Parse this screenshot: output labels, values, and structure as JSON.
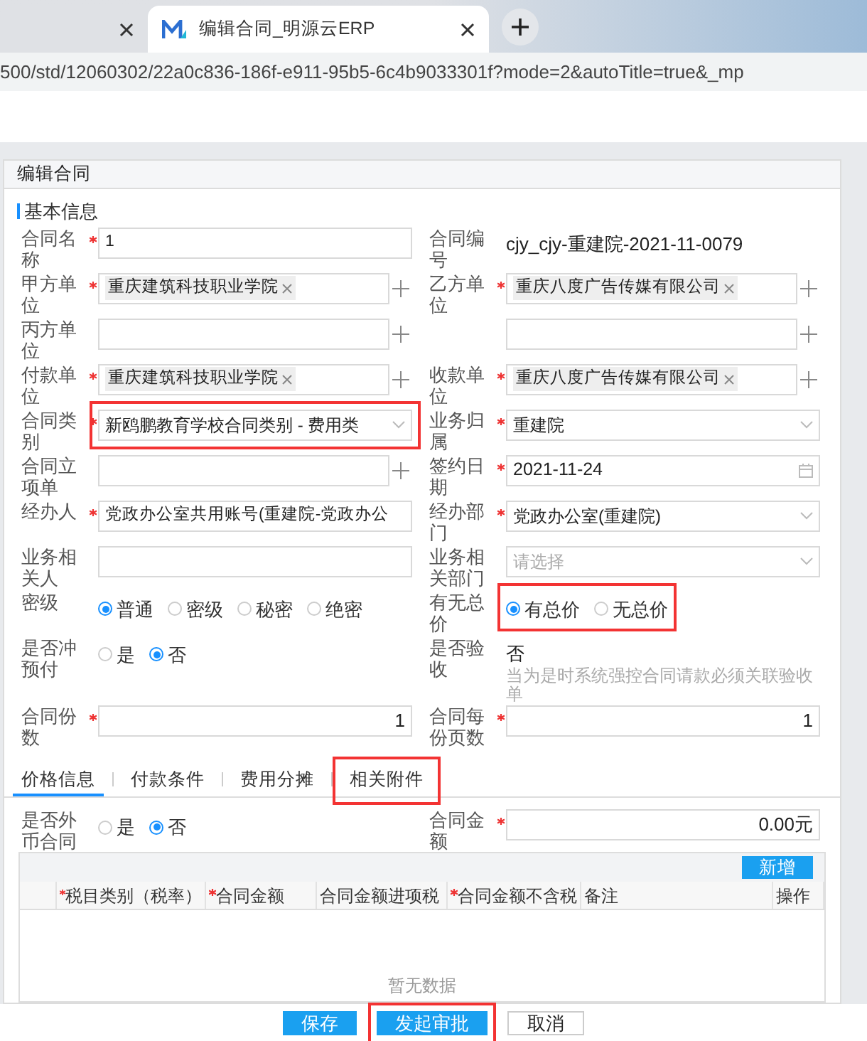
{
  "browser": {
    "tabs": [
      {
        "selected": false
      },
      {
        "title": "编辑合同_明源云ERP",
        "selected": true
      }
    ],
    "url": "500/std/12060302/22a0c836-186f-e911-95b5-6c4b9033301f?mode=2&autoTitle=true&_mp"
  },
  "panel_title": "编辑合同",
  "section_title": "基本信息",
  "rows": [
    [
      {
        "label": "合同名称",
        "required": true,
        "kind": "text",
        "value": "1"
      },
      {
        "label": "合同编号",
        "required": false,
        "kind": "readonly",
        "value": "cjy_cjy-重建院-2021-11-0079"
      }
    ],
    [
      {
        "label": "甲方单位",
        "required": true,
        "kind": "tags",
        "tags": [
          "重庆建筑科技职业学院"
        ],
        "plus": true
      },
      {
        "label": "乙方单位",
        "required": true,
        "kind": "tags",
        "tags": [
          "重庆八度广告传媒有限公司"
        ],
        "plus": true
      }
    ],
    [
      {
        "label": "丙方单位",
        "required": false,
        "kind": "tags",
        "plus": true
      },
      {
        "required": false,
        "kind": "tags",
        "plus": true
      }
    ],
    [
      {
        "label": "付款单位",
        "required": true,
        "kind": "tags",
        "tags": [
          "重庆建筑科技职业学院"
        ],
        "plus": true
      },
      {
        "label": "收款单位",
        "required": true,
        "kind": "tags",
        "tags": [
          "重庆八度广告传媒有限公司"
        ],
        "plus": true
      }
    ],
    [
      {
        "label": "合同类别",
        "required": true,
        "kind": "select",
        "value": "新鸥鹏教育学校合同类别 - 费用类",
        "highlighted": true
      },
      {
        "label": "业务归属",
        "required": true,
        "kind": "select",
        "value": "重建院"
      }
    ],
    [
      {
        "label": "合同立项单",
        "required": false,
        "kind": "tags",
        "plus": true
      },
      {
        "label": "签约日期",
        "required": true,
        "kind": "date",
        "value": "2021-11-24"
      }
    ],
    [
      {
        "label": "经办人",
        "required": true,
        "kind": "text",
        "value": "党政办公室共用账号(重建院-党政办公"
      },
      {
        "label": "经办部门",
        "required": true,
        "kind": "select",
        "value": "党政办公室(重建院)"
      }
    ],
    [
      {
        "label": "业务相关人",
        "required": false,
        "kind": "text"
      },
      {
        "label": "业务相关部门",
        "required": false,
        "kind": "select",
        "placeholder": "请选择"
      }
    ],
    [
      {
        "label": "密级",
        "required": false,
        "kind": "radios",
        "options": [
          {
            "label": "普通",
            "selected": true
          },
          {
            "label": "密级",
            "selected": false
          },
          {
            "label": "秘密",
            "selected": false
          },
          {
            "label": "绝密",
            "selected": false
          }
        ]
      },
      {
        "label": "有无总价",
        "required": false,
        "kind": "radios",
        "highlighted": true,
        "options": [
          {
            "label": "有总价",
            "selected": true
          },
          {
            "label": "无总价",
            "selected": false
          }
        ]
      }
    ],
    [
      {
        "label": "是否冲预付",
        "required": false,
        "kind": "radios",
        "options": [
          {
            "label": "是",
            "selected": false
          },
          {
            "label": "否",
            "selected": true
          }
        ]
      },
      {
        "label": "是否验收",
        "required": false,
        "kind": "readonly",
        "value": "否",
        "hint": "当为是时系统强控合同请款必须关联验收单"
      }
    ],
    [
      {
        "label": "合同份数",
        "required": true,
        "kind": "number",
        "value": "1"
      },
      {
        "label": "合同每份页数",
        "required": true,
        "kind": "number",
        "value": "1"
      }
    ]
  ],
  "detail_tabs": [
    {
      "label": "价格信息",
      "selected": true
    },
    {
      "label": "付款条件",
      "selected": false
    },
    {
      "label": "费用分摊",
      "selected": false
    },
    {
      "label": "相关附件",
      "selected": false,
      "highlighted": true
    }
  ],
  "price_row": [
    {
      "label": "是否外币合同",
      "required": false,
      "kind": "radios",
      "options": [
        {
          "label": "是",
          "selected": false
        },
        {
          "label": "否",
          "selected": true
        }
      ]
    },
    {
      "label": "合同金额",
      "required": true,
      "kind": "number",
      "value": "0.00",
      "unit": "元"
    }
  ],
  "table": {
    "add_button": "新增",
    "columns": [
      {
        "required": false
      },
      {
        "label": "税目类别（税率）",
        "required": true
      },
      {
        "label": "合同金额",
        "required": true
      },
      {
        "label": "合同金额进项税",
        "required": false
      },
      {
        "label": "合同金额不含税",
        "required": true
      },
      {
        "label": "备注",
        "required": false
      },
      {
        "label": "操作",
        "required": false
      }
    ],
    "empty_text": "暂无数据"
  },
  "footer_buttons": [
    {
      "label": "保存",
      "kind": "primary"
    },
    {
      "label": "发起审批",
      "kind": "primary",
      "highlighted": true
    },
    {
      "label": "取消",
      "kind": "default"
    }
  ]
}
